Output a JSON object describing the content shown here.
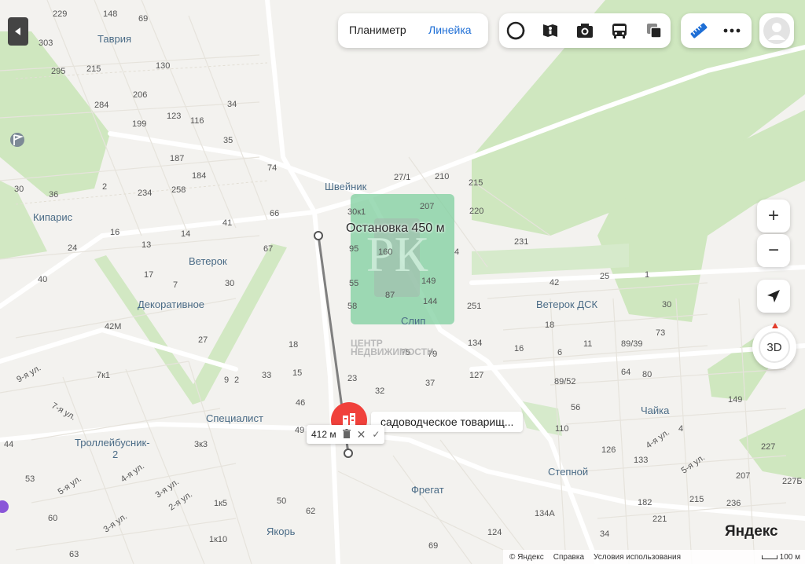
{
  "toolbar": {
    "planimeter_label": "Планиметр",
    "ruler_label": "Линейка"
  },
  "icons": {
    "collapse": "triangle-left-icon",
    "layers_circle": "circle-layer-icon",
    "panorama": "panorama-person-icon",
    "photo": "camera-icon",
    "transport": "bus-icon",
    "layers": "layers-icon",
    "ruler": "ruler-icon",
    "more": "more-dots-icon",
    "profile": "avatar-icon",
    "pin": "building-pin-icon"
  },
  "controls": {
    "zoom_in": "+",
    "zoom_out": "−",
    "threed": "3D"
  },
  "overlay": {
    "stop_label": "Остановка 450 м",
    "watermark_line1": "ЦЕНТР",
    "watermark_line2": "НЕДВИЖИМОСТИ"
  },
  "ruler_popup": {
    "distance": "412 м"
  },
  "poi": {
    "label": "садоводческое товарищ..."
  },
  "places": [
    {
      "id": "tavria",
      "text": "Таврия"
    },
    {
      "id": "kiparis",
      "text": "Кипарис"
    },
    {
      "id": "veterok",
      "text": "Ветерок"
    },
    {
      "id": "dekor",
      "text": "Декоративное"
    },
    {
      "id": "shveynik",
      "text": "Швейник"
    },
    {
      "id": "slip",
      "text": "Слип"
    },
    {
      "id": "veterokdsk",
      "text": "Ветерок ДСК"
    },
    {
      "id": "specialist",
      "text": "Специалист"
    },
    {
      "id": "trolley",
      "text": "Троллейбусник-"
    },
    {
      "id": "trolley2",
      "text": "2"
    },
    {
      "id": "chayka",
      "text": "Чайка"
    },
    {
      "id": "stepnoy",
      "text": "Степной"
    },
    {
      "id": "fregat",
      "text": "Фрегат"
    },
    {
      "id": "yakor",
      "text": "Якорь"
    }
  ],
  "streets": [
    {
      "id": "s9",
      "text": "9-я ул."
    },
    {
      "id": "s7",
      "text": "7-я ул."
    },
    {
      "id": "s5",
      "text": "5-я ул."
    },
    {
      "id": "s4",
      "text": "4-я ул."
    },
    {
      "id": "s3a",
      "text": "3-я ул."
    },
    {
      "id": "s2",
      "text": "2-я ул."
    },
    {
      "id": "s3b",
      "text": "3-я ул."
    },
    {
      "id": "s4r",
      "text": "4-я ул."
    },
    {
      "id": "s5r",
      "text": "5-я ул."
    }
  ],
  "house_numbers": [
    "229",
    "148",
    "69",
    "303",
    "295",
    "215",
    "130",
    "206",
    "284",
    "199",
    "123",
    "116",
    "34",
    "35",
    "187",
    "184",
    "74",
    "258",
    "234",
    "30",
    "36",
    "2",
    "66",
    "41",
    "14",
    "24",
    "16",
    "13",
    "67",
    "40",
    "17",
    "7",
    "30",
    "42М",
    "27",
    "9",
    "18",
    "15",
    "7к1",
    "33",
    "2",
    "23",
    "32",
    "37",
    "46",
    "49",
    "3к3",
    "1к5",
    "50",
    "62",
    "1к10",
    "44",
    "53",
    "60",
    "63",
    "27/1",
    "210",
    "215",
    "207",
    "220",
    "30к1",
    "231",
    "95",
    "160",
    "4",
    "55",
    "149",
    "58",
    "87",
    "144",
    "251",
    "134",
    "127",
    "75",
    "79",
    "42",
    "25",
    "1",
    "30",
    "18",
    "73",
    "16",
    "6",
    "11",
    "89/39",
    "89/52",
    "64",
    "80",
    "56",
    "110",
    "126",
    "133",
    "4",
    "149",
    "227",
    "207",
    "182",
    "215",
    "236",
    "221",
    "227Б",
    "134А",
    "124",
    "69",
    "34"
  ],
  "pin_points": [
    "5",
    "2"
  ],
  "logo": {
    "text": "Яндекс"
  },
  "footer": {
    "copyright": "© Яндекс",
    "help": "Справка",
    "terms": "Условия использования",
    "scale": "100 м"
  }
}
